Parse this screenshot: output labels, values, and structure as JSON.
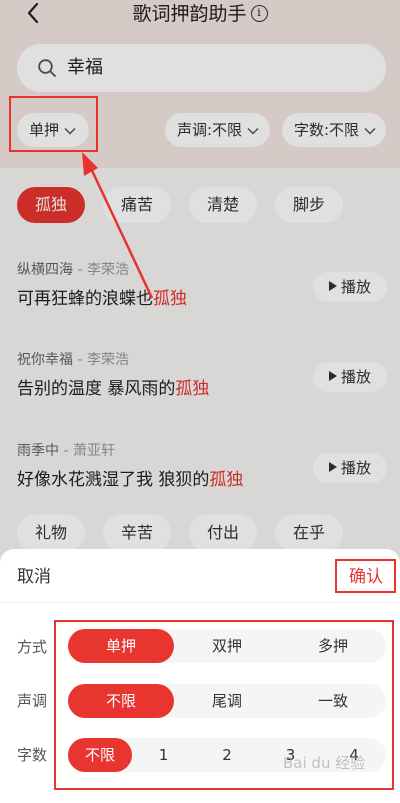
{
  "header": {
    "title": "歌词押韵助手",
    "info_symbol": "i"
  },
  "search": {
    "value": "幸福"
  },
  "filters": {
    "rhyme_type": "单押",
    "tone": "声调:不限",
    "char_count": "字数:不限"
  },
  "tags_top": [
    {
      "label": "孤独",
      "active": true
    },
    {
      "label": "痛苦",
      "active": false
    },
    {
      "label": "清楚",
      "active": false
    },
    {
      "label": "脚步",
      "active": false
    }
  ],
  "songs": [
    {
      "title": "纵横四海",
      "artist": "李荣浩",
      "lyric_prefix": "可再狂蜂的浪蝶也",
      "lyric_highlight": "孤独",
      "play_label": "播放"
    },
    {
      "title": "祝你幸福",
      "artist": "李荣浩",
      "lyric_prefix": "告别的温度 暴风雨的",
      "lyric_highlight": "孤独",
      "play_label": "播放"
    },
    {
      "title": "雨季中",
      "artist": "萧亚轩",
      "lyric_prefix": "好像水花溅湿了我 狼狈的",
      "lyric_highlight": "孤独",
      "play_label": "播放"
    }
  ],
  "song_separator": " - ",
  "tags_bottom": [
    {
      "label": "礼物"
    },
    {
      "label": "辛苦"
    },
    {
      "label": "付出"
    },
    {
      "label": "在乎"
    }
  ],
  "sheet": {
    "cancel_label": "取消",
    "confirm_label": "确认",
    "rows": [
      {
        "label": "方式",
        "options": [
          "单押",
          "双押",
          "多押"
        ],
        "selected_index": 0
      },
      {
        "label": "声调",
        "options": [
          "不限",
          "尾调",
          "一致"
        ],
        "selected_index": 0
      },
      {
        "label": "字数",
        "options": [
          "不限",
          "1",
          "2",
          "3",
          "4"
        ],
        "selected_index": 0
      }
    ]
  },
  "watermark": "Bai du 经验",
  "colors": {
    "accent": "#e8352f",
    "annotation_red": "#e8322f",
    "top_background": "#f4e6e2"
  },
  "icons": [
    "back-arrow-icon",
    "info-icon",
    "search-icon",
    "chevron-down-icon",
    "play-icon"
  ]
}
